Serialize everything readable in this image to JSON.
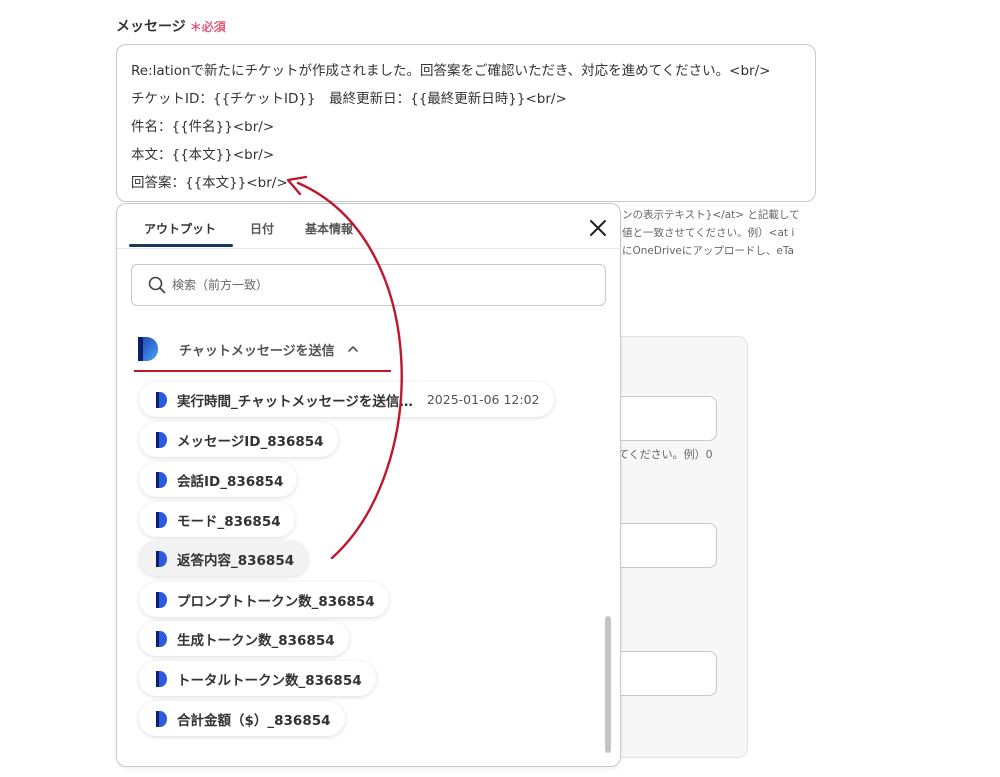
{
  "field": {
    "label": "メッセージ",
    "required": "＊必須"
  },
  "message_lines": [
    "Re:lationで新たにチケットが作成されました。回答案をご確認いただき、対応を進めてください。<br/>",
    "チケットID：{{チケットID}}　最終更新日：{{最終更新日時}}<br/>",
    "件名：{{件名}}<br/>",
    "本文：{{本文}}<br/>",
    "回答案：{{本文}}<br/>"
  ],
  "help_lines": [
    "ンの表示テキスト}</at> と記載して",
    "値と一致させてください。例）<at i",
    "にOneDriveにアップロードし、eTa"
  ],
  "background_hint": "てください。例）0",
  "popup": {
    "tabs": [
      "アウトプット",
      "日付",
      "基本情報"
    ],
    "active_tab": "アウトプット",
    "search_placeholder": "検索（前方一致）",
    "group_title": "チャットメッセージを送信",
    "items": [
      {
        "label": "実行時間_チャットメッセージを送信…",
        "value": "2025-01-06 12:02"
      },
      {
        "label": "メッセージID_836854",
        "value": ""
      },
      {
        "label": "会話ID_836854",
        "value": ""
      },
      {
        "label": "モード_836854",
        "value": ""
      },
      {
        "label": "返答内容_836854",
        "value": ""
      },
      {
        "label": "プロンプトトークン数_836854",
        "value": ""
      },
      {
        "label": "生成トークン数_836854",
        "value": ""
      },
      {
        "label": "トータルトークン数_836854",
        "value": ""
      },
      {
        "label": "合計金額（$）_836854",
        "value": ""
      }
    ]
  },
  "colors": {
    "annotation": "#c0162c",
    "brand": "#1f4fd6",
    "required": "#e25b78"
  },
  "icons": {
    "close": "close-icon",
    "search": "search-icon",
    "chevron": "chevron-up-icon",
    "app": "app-logo-icon"
  }
}
